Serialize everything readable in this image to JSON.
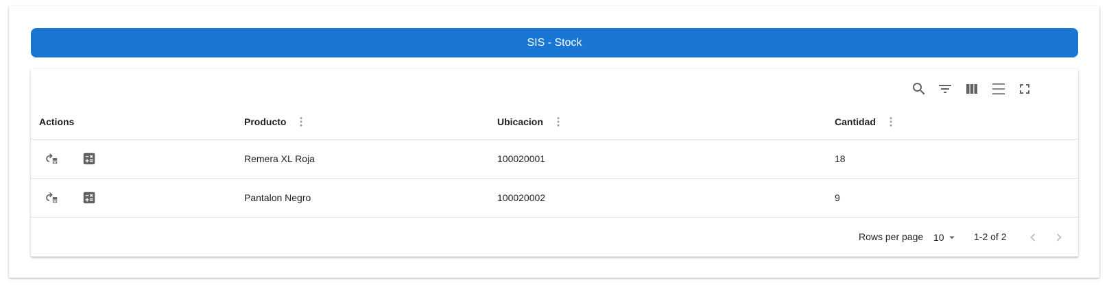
{
  "title": "SIS - Stock",
  "toolbar": {
    "icons": [
      "search-icon",
      "filter-icon",
      "view-column-icon",
      "density-icon",
      "fullscreen-icon"
    ]
  },
  "table": {
    "columns": [
      "Actions",
      "Producto",
      "Ubicacion",
      "Cantidad"
    ],
    "rows": [
      {
        "producto": "Remera XL Roja",
        "ubicacion": "100020001",
        "cantidad": "18"
      },
      {
        "producto": "Pantalon Negro",
        "ubicacion": "100020002",
        "cantidad": "9"
      }
    ],
    "row_actions": [
      "transfer-icon",
      "calculate-icon"
    ]
  },
  "pagination": {
    "rows_per_page_label": "Rows per page",
    "rows_per_page_value": "10",
    "range": "1-2 of 2"
  },
  "colors": {
    "accent": "#1976d2",
    "icon": "#616161",
    "divider": "#e0e0e0"
  }
}
